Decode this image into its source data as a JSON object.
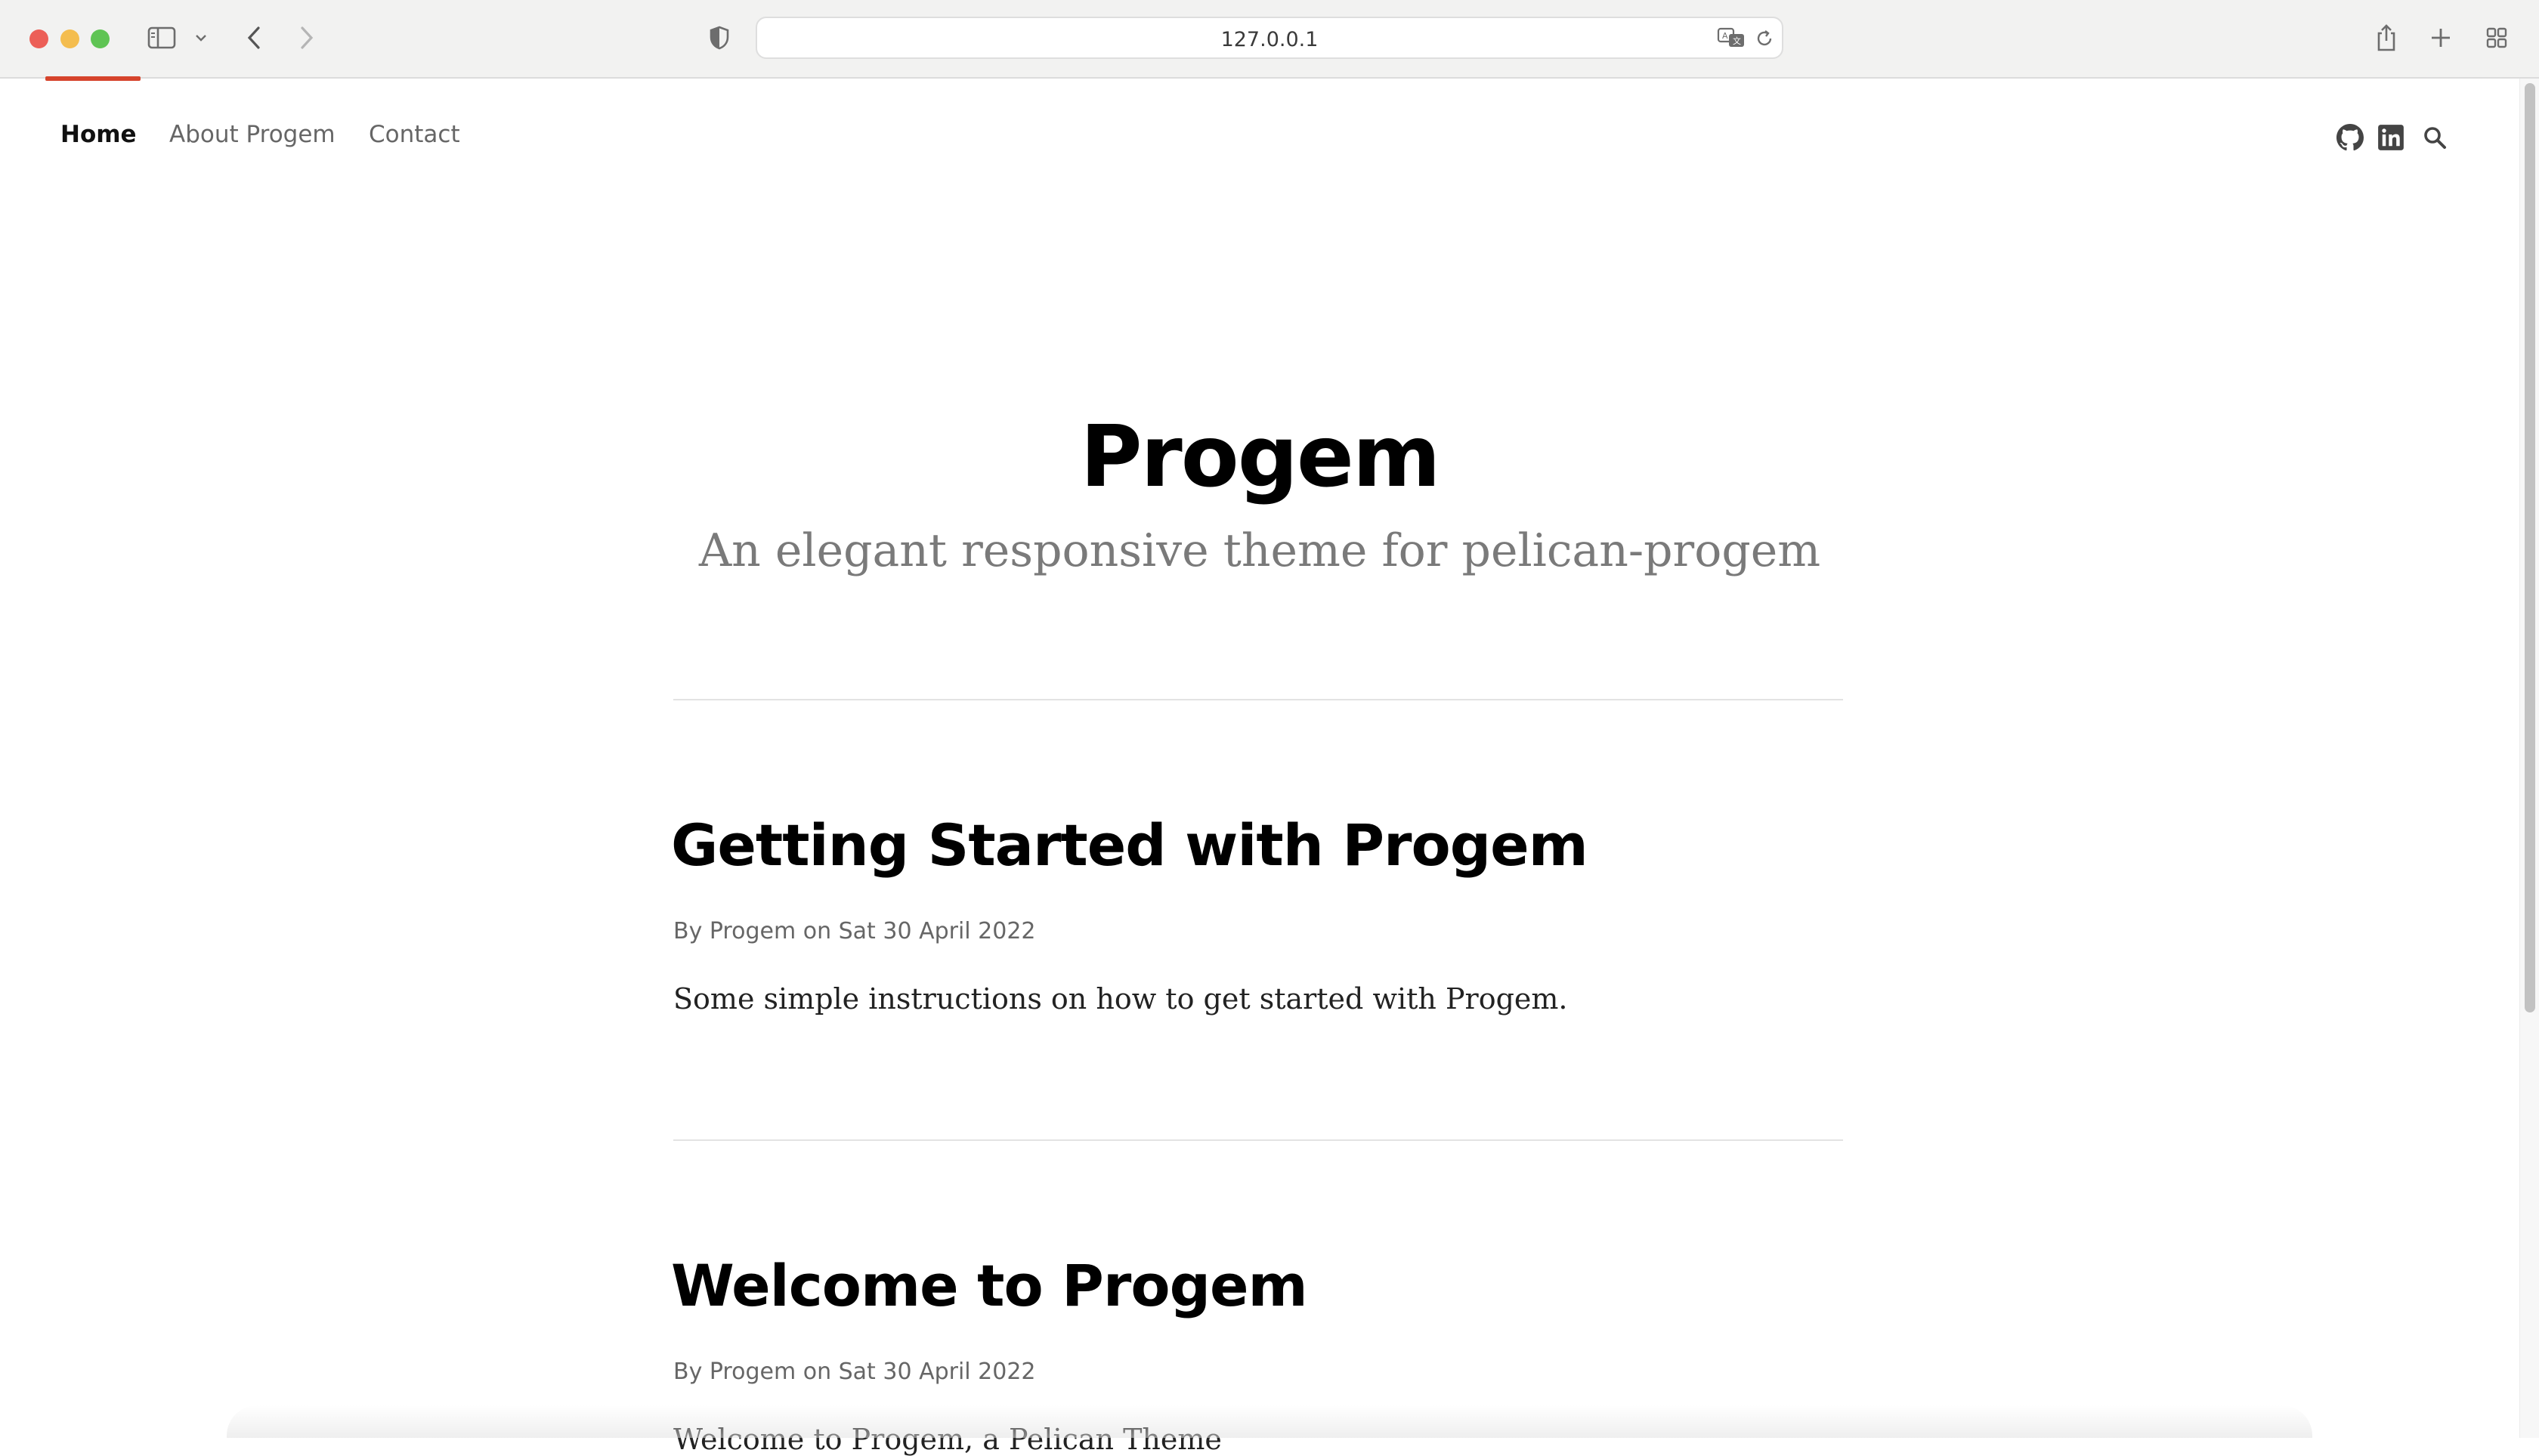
{
  "browser": {
    "url": "127.0.0.1"
  },
  "nav": {
    "items": [
      {
        "label": "Home",
        "active": true
      },
      {
        "label": "About Progem",
        "active": false
      },
      {
        "label": "Contact",
        "active": false
      }
    ],
    "icons": [
      "github-icon",
      "linkedin-icon",
      "search-icon"
    ]
  },
  "header": {
    "title": "Progem",
    "subtitle": "An elegant responsive theme for pelican-progem"
  },
  "posts": [
    {
      "title": "Getting Started with Progem",
      "meta_prefix": "By Progem on",
      "date": "Sat 30 April 2022",
      "meta": "By Progem on Sat 30 April 2022",
      "summary": "Some simple instructions on how to get started with Progem."
    },
    {
      "title": "Welcome to Progem",
      "meta_prefix": "By Progem on",
      "date": "Sat 30 April 2022",
      "meta": "By Progem on Sat 30 April 2022",
      "summary": "Welcome to Progem, a Pelican Theme"
    }
  ],
  "colors": {
    "accent": "#d6442c",
    "title": "#000000",
    "muted": "#666666",
    "subtitle": "#7a7a7a"
  }
}
